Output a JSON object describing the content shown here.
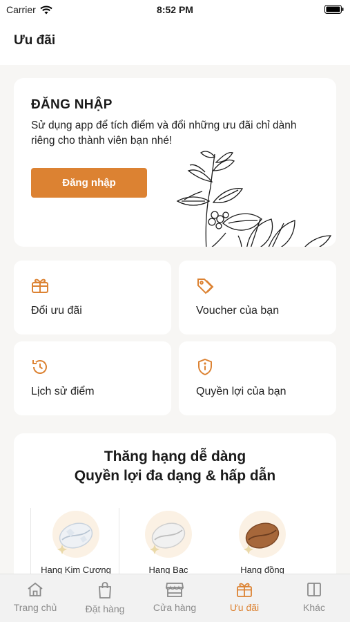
{
  "status_bar": {
    "carrier": "Carrier",
    "time": "8:52 PM"
  },
  "header": {
    "title": "Ưu đãi"
  },
  "login_card": {
    "title": "ĐĂNG NHẬP",
    "description": "Sử dụng app để tích điểm và đổi những ưu đãi chỉ dành riêng cho thành viên bạn nhé!",
    "button_label": "Đăng nhập"
  },
  "features": [
    {
      "label": "Đổi ưu đãi",
      "icon": "gift-icon"
    },
    {
      "label": "Voucher của bạn",
      "icon": "tag-icon"
    },
    {
      "label": "Lịch sử điểm",
      "icon": "history-icon"
    },
    {
      "label": "Quyền lợi của bạn",
      "icon": "shield-info-icon"
    }
  ],
  "rank_section": {
    "heading_line1": "Thăng hạng dễ dàng",
    "heading_line2": "Quyền lợi đa dạng & hấp dẫn",
    "ranks": [
      {
        "label": "Hạng Kim Cương",
        "icon": "diamond-bean-icon"
      },
      {
        "label": "Hạng Bạc",
        "icon": "silver-bean-icon"
      },
      {
        "label": "Hạng đồng",
        "icon": "bronze-bean-icon"
      }
    ]
  },
  "tab_bar": {
    "tabs": [
      {
        "label": "Trang chủ",
        "icon": "home-icon"
      },
      {
        "label": "Đặt hàng",
        "icon": "bag-icon"
      },
      {
        "label": "Cửa hàng",
        "icon": "store-icon"
      },
      {
        "label": "Ưu đãi",
        "icon": "gift-icon"
      },
      {
        "label": "Khác",
        "icon": "menu-icon"
      }
    ],
    "active_index": 3
  },
  "colors": {
    "accent": "#dc8232",
    "inactive": "#8a8a8a",
    "background": "#f7f6f4"
  }
}
